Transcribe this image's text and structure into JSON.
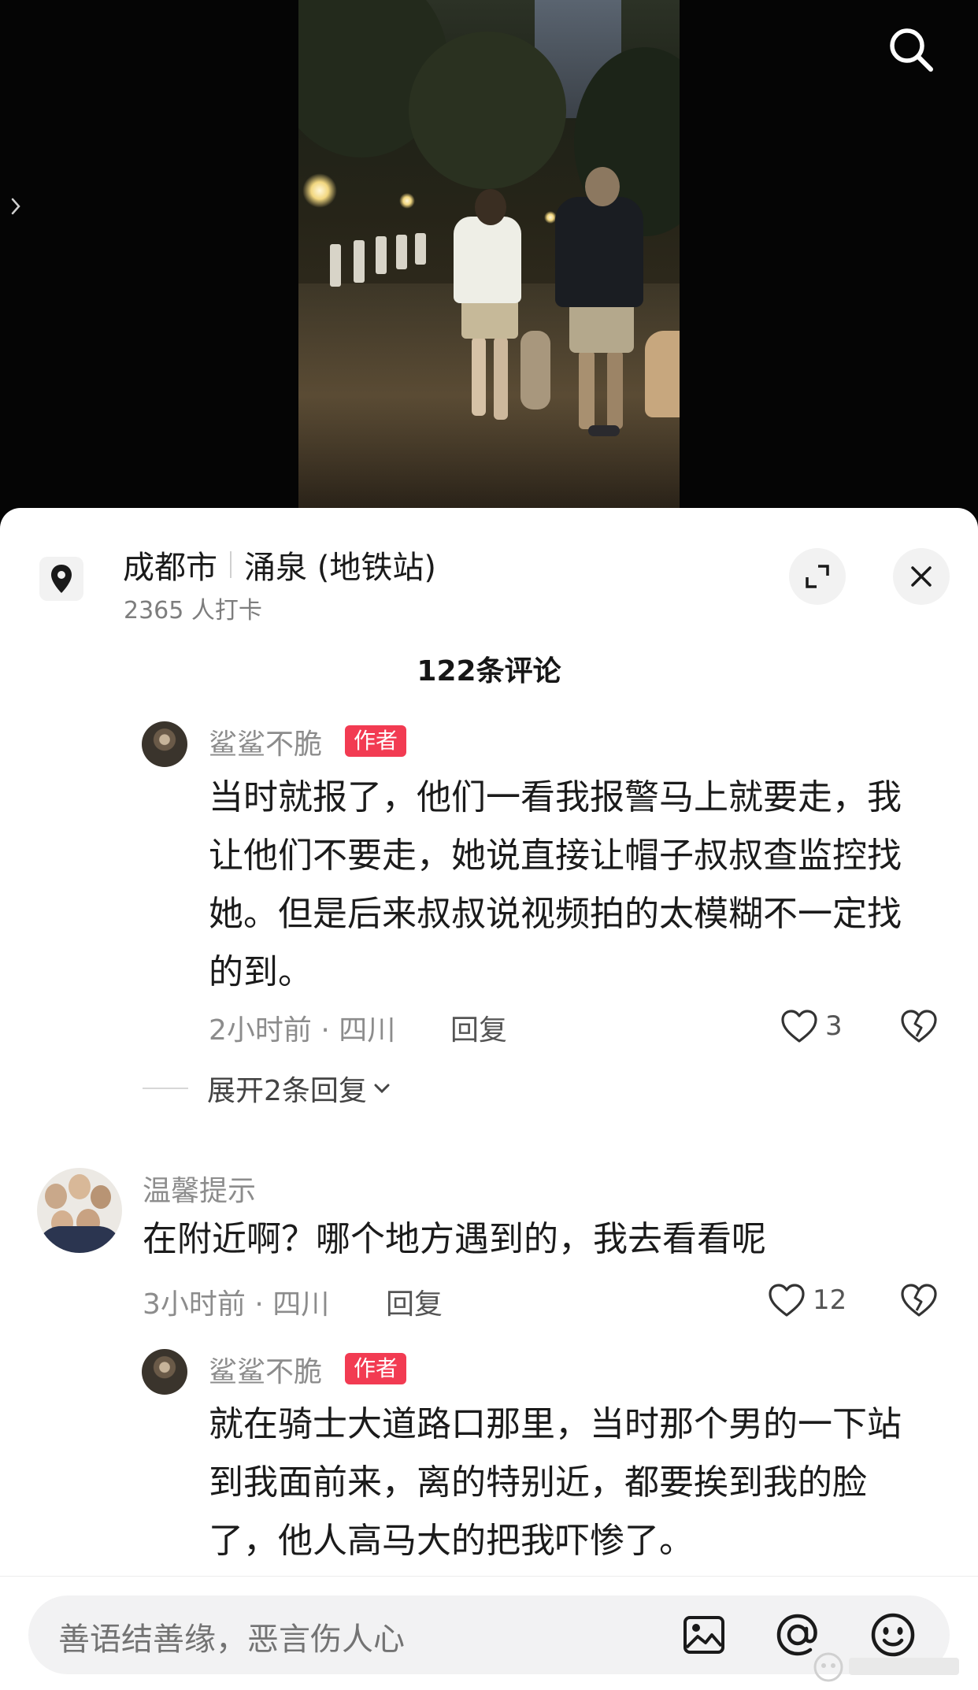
{
  "location": {
    "city": "成都市",
    "place": "涌泉 (地铁站)",
    "checkins": "2365 人打卡"
  },
  "comments_header": "122条评论",
  "comments": [
    {
      "name": "鲨鲨不脆",
      "tag": "作者",
      "text": "当时就报了，他们一看我报警马上就要走，我让他们不要走，她说直接让帽子叔叔查监控找她。但是后来叔叔说视频拍的太模糊不一定找的到。",
      "meta": "2小时前 · 四川",
      "reply": "回复",
      "likes": "3",
      "expand": "展开2条回复"
    },
    {
      "name": "温馨提示",
      "text": "在附近啊？哪个地方遇到的，我去看看呢",
      "meta": "3小时前 · 四川",
      "reply": "回复",
      "likes": "12"
    },
    {
      "name": "鲨鲨不脆",
      "tag": "作者",
      "text": "就在骑士大道路口那里，当时那个男的一下站到我面前来，离的特别近，都要挨到我的脸了，他人高马大的把我吓惨了。"
    }
  ],
  "input": {
    "placeholder": "善语结善缘，恶言伤人心"
  },
  "icons": {
    "search": "search-icon",
    "location": "location-pin-icon",
    "fullscreen": "fullscreen-icon",
    "close": "close-icon",
    "like": "heart-icon",
    "dislike": "broken-heart-icon",
    "image": "image-icon",
    "mention": "at-icon",
    "emoji": "emoji-icon"
  },
  "colors": {
    "author_tag": "#f23b52",
    "sheet_bg": "#ffffff",
    "input_bg": "#f2f2f3"
  }
}
